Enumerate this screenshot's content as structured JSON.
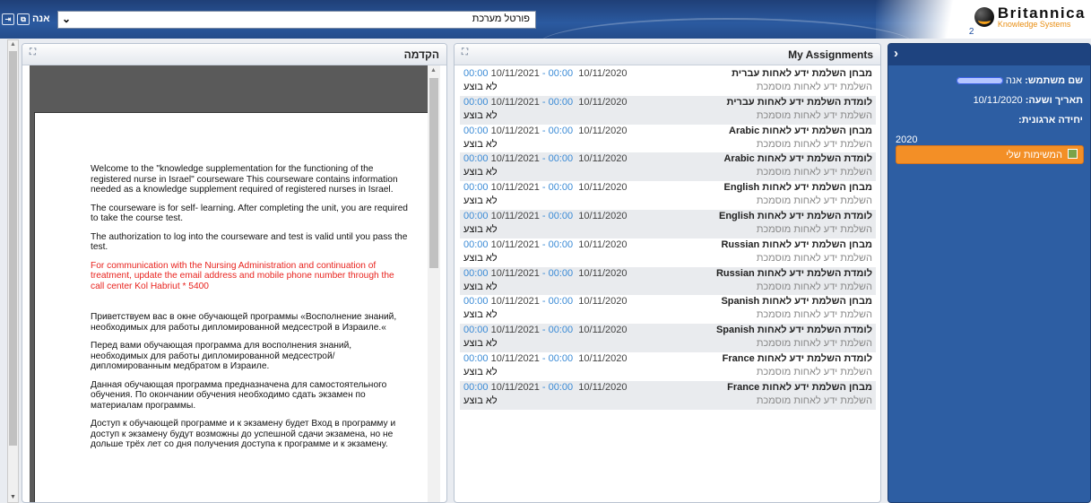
{
  "header": {
    "portal_select": "פורטל מערכת",
    "user_label": "אנה",
    "logo_brand": "Britannica",
    "logo_sub": "Knowledge Systems",
    "logo_badge": "2"
  },
  "intro": {
    "title": "הקדמה",
    "paragraphs": [
      "Welcome to the \"knowledge supplementation for the functioning of the registered nurse in Israel\" courseware This courseware contains information needed as a knowledge supplement required of registered nurses in Israel.",
      "The courseware is for self- learning. After completing the unit, you are required to take the course test.",
      "The authorization to log into the courseware and test is valid until you pass the test.",
      "For communication with the Nursing Administration and continuation of treatment, update the email address and mobile phone number through the call center Kol Habriut * 5400",
      "Приветствуем вас в окне обучающей программы «Восполнение знаний, необходимых для работы дипломированной медсестрой в Израиле.«",
      "Перед вами обучающая программа для восполнения знаний, необходимых для работы дипломированной медсестрой/дипломированным медбратом в Израиле.",
      "Данная обучающая программа предназначена для самостоятельного обучения. По окончании обучения необходимо сдать экзамен по материалам программы.",
      "Доступ к обучающей программе и к экзамену будет Вход в программу и доступ к экзамену будут возможны до успешной сдачи экзамена, но не дольше трёх лет со дня получения доступа к программе и к экзамену."
    ]
  },
  "assignments": {
    "title": "My Assignments",
    "items": [
      {
        "name": "מבחן השלמת ידע לאחות עברית",
        "date_start": "10/11/2020",
        "time_start": "00:00",
        "date_end": "10/11/2021",
        "time_end": "00:00",
        "desc": "השלמת ידע לאחות מוסמכת",
        "status": "לא בוצע"
      },
      {
        "name": "לומדת השלמת ידע לאחות עברית",
        "date_start": "10/11/2020",
        "time_start": "00:00",
        "date_end": "10/11/2021",
        "time_end": "00:00",
        "desc": "השלמת ידע לאחות מוסמכת",
        "status": "לא בוצע"
      },
      {
        "name": "מבחן השלמת ידע לאחות Arabic",
        "date_start": "10/11/2020",
        "time_start": "00:00",
        "date_end": "10/11/2021",
        "time_end": "00:00",
        "desc": "השלמת ידע לאחות מוסמכת",
        "status": "לא בוצע"
      },
      {
        "name": "לומדת השלמת ידע לאחות Arabic",
        "date_start": "10/11/2020",
        "time_start": "00:00",
        "date_end": "10/11/2021",
        "time_end": "00:00",
        "desc": "השלמת ידע לאחות מוסמכת",
        "status": "לא בוצע"
      },
      {
        "name": "מבחן השלמת ידע לאחות English",
        "date_start": "10/11/2020",
        "time_start": "00:00",
        "date_end": "10/11/2021",
        "time_end": "00:00",
        "desc": "השלמת ידע לאחות מוסמכת",
        "status": "לא בוצע"
      },
      {
        "name": "לומדת השלמת ידע לאחות English",
        "date_start": "10/11/2020",
        "time_start": "00:00",
        "date_end": "10/11/2021",
        "time_end": "00:00",
        "desc": "השלמת ידע לאחות מוסמכת",
        "status": "לא בוצע"
      },
      {
        "name": "מבחן השלמת ידע לאחות Russian",
        "date_start": "10/11/2020",
        "time_start": "00:00",
        "date_end": "10/11/2021",
        "time_end": "00:00",
        "desc": "השלמת ידע לאחות מוסמכת",
        "status": "לא בוצע"
      },
      {
        "name": "לומדת השלמת ידע לאחות Russian",
        "date_start": "10/11/2020",
        "time_start": "00:00",
        "date_end": "10/11/2021",
        "time_end": "00:00",
        "desc": "השלמת ידע לאחות מוסמכת",
        "status": "לא בוצע"
      },
      {
        "name": "מבחן השלמת ידע לאחות Spanish",
        "date_start": "10/11/2020",
        "time_start": "00:00",
        "date_end": "10/11/2021",
        "time_end": "00:00",
        "desc": "השלמת ידע לאחות מוסמכת",
        "status": "לא בוצע"
      },
      {
        "name": "לומדת השלמת ידע לאחות Spanish",
        "date_start": "10/11/2020",
        "time_start": "00:00",
        "date_end": "10/11/2021",
        "time_end": "00:00",
        "desc": "השלמת ידע לאחות מוסמכת",
        "status": "לא בוצע"
      },
      {
        "name": "לומדת השלמת ידע לאחות France",
        "date_start": "10/11/2020",
        "time_start": "00:00",
        "date_end": "10/11/2021",
        "time_end": "00:00",
        "desc": "השלמת ידע לאחות מוסמכת",
        "status": "לא בוצע"
      },
      {
        "name": "מבחן השלמת ידע לאחות France",
        "date_start": "10/11/2020",
        "time_start": "00:00",
        "date_end": "10/11/2021",
        "time_end": "00:00",
        "desc": "השלמת ידע לאחות מוסמכת",
        "status": "לא בוצע"
      }
    ]
  },
  "sidebar": {
    "username_label": "שם משתמש:",
    "username_value": "אנה",
    "date_label": "תאריך ושעה:",
    "date_value": "10/11/2020",
    "org_label": "יחידה ארגונית:",
    "org_value": "2020",
    "my_tasks_button": "המשימות שלי"
  }
}
